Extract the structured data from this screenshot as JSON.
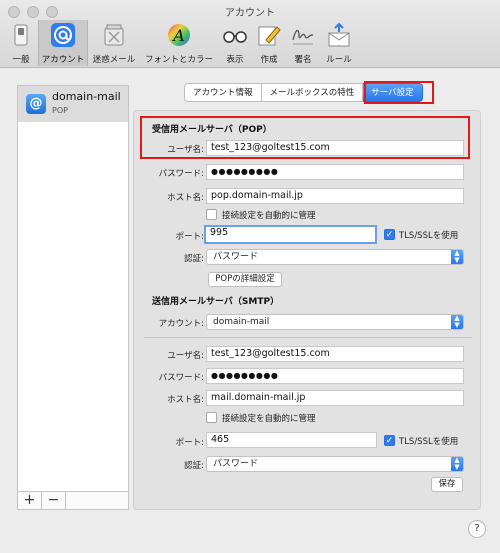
{
  "window": {
    "title": "アカウント"
  },
  "toolbar": {
    "items": [
      {
        "label": "一般",
        "icon": "switch-icon"
      },
      {
        "label": "アカウント",
        "icon": "at-icon"
      },
      {
        "label": "迷惑メール",
        "icon": "junk-trash-icon"
      },
      {
        "label": "フォントとカラー",
        "icon": "font-color-icon"
      },
      {
        "label": "表示",
        "icon": "glasses-icon"
      },
      {
        "label": "作成",
        "icon": "compose-pencil-icon"
      },
      {
        "label": "署名",
        "icon": "signature-icon"
      },
      {
        "label": "ルール",
        "icon": "rules-envelope-icon"
      }
    ]
  },
  "sidebar": {
    "account": {
      "name": "domain-mail",
      "type": "POP"
    },
    "add_label": "+",
    "remove_label": "−"
  },
  "tabs": {
    "items": [
      "アカウント情報",
      "メールボックスの特性",
      "サーバ設定"
    ],
    "active": "サーバ設定"
  },
  "incoming": {
    "section_title": "受信用メールサーバ（POP）",
    "username_label": "ユーザ名:",
    "username": "test_123@goltest15.com",
    "password_label": "パスワード:",
    "password": "●●●●●●●●●",
    "host_label": "ホスト名:",
    "host": "pop.domain-mail.jp",
    "auto_manage_label": "接続設定を自動的に管理",
    "port_label": "ポート:",
    "port": "995",
    "tls_label": "TLS/SSLを使用",
    "auth_label": "認証:",
    "auth": "パスワード",
    "advanced_button": "POPの詳細設定"
  },
  "outgoing": {
    "section_title": "送信用メールサーバ（SMTP）",
    "account_label": "アカウント:",
    "account": "domain-mail",
    "username_label": "ユーザ名:",
    "username": "test_123@goltest15.com",
    "password_label": "パスワード:",
    "password": "●●●●●●●●●",
    "host_label": "ホスト名:",
    "host": "mail.domain-mail.jp",
    "auto_manage_label": "接続設定を自動的に管理",
    "port_label": "ポート:",
    "port": "465",
    "tls_label": "TLS/SSLを使用",
    "auth_label": "認証:",
    "auth": "パスワード",
    "save_button": "保存"
  },
  "help_label": "?",
  "colors": {
    "accent": "#2a78ee",
    "highlight": "#e01818"
  }
}
